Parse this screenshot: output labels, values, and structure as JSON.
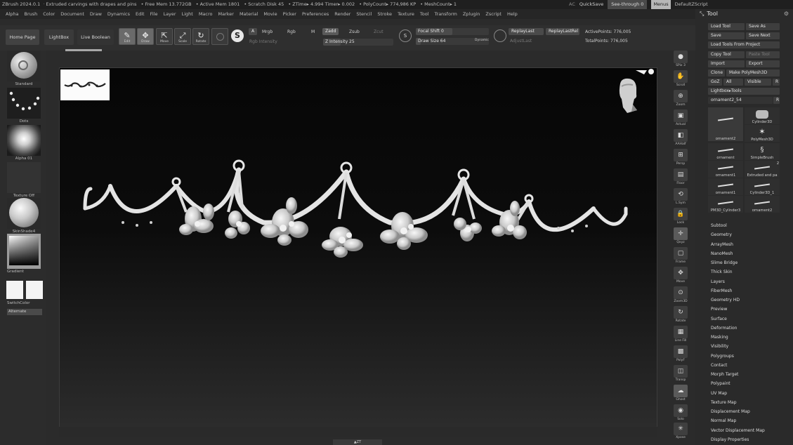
{
  "titlebar": {
    "segments": [
      "ZBrush 2024.0.1",
      "Extruded carvings with drapes and pins",
      "• Free Mem 13.772GB",
      "• Active Mem 1801",
      "• Scratch Disk 45",
      "• ZTime▸ 4.994 Timer▸ 0.002",
      "• PolyCount▸ 774,986 KP",
      "• MeshCount▸ 1"
    ],
    "ac_label": "AC",
    "quicksave": "QuickSave",
    "seethrough": "See-through 0",
    "menus": "Menus",
    "zscript": "DefaultZScript"
  },
  "menubar": [
    "Alpha",
    "Brush",
    "Color",
    "Document",
    "Draw",
    "Dynamics",
    "Edit",
    "File",
    "Layer",
    "Light",
    "Macro",
    "Marker",
    "Material",
    "Movie",
    "Picker",
    "Preferences",
    "Render",
    "Stencil",
    "Stroke",
    "Texture",
    "Tool",
    "Transform",
    "Zplugin",
    "Zscript",
    "Help"
  ],
  "toolbar": {
    "home": "Home Page",
    "lightbox": "LightBox",
    "live_boolean": "Live Boolean",
    "edit": "Edit",
    "draw": "Draw",
    "move": "Move",
    "scale": "Scale",
    "rotate": "Rotate",
    "a_toggle": "A",
    "mrgb": "Mrgb",
    "rgb": "Rgb",
    "m": "M",
    "zadd": "Zadd",
    "zsub": "Zsub",
    "zcut": "Zcut",
    "rgb_intensity": "Rgb Intensity",
    "z_intensity": "Z Intensity 25",
    "z_intensity_value": 25,
    "focal_shift": "Focal Shift 0",
    "focal_shift_value": 0,
    "draw_size": "Draw Size 64",
    "draw_size_value": 64,
    "dynamic": "Dynamic",
    "replay_last": "ReplayLast",
    "replay_last_rel": "ReplayLastRel",
    "adjust_last": "AdjustLast",
    "active_points": "ActivePoints: 776,005",
    "total_points": "TotalPoints: 776,005"
  },
  "leftshelf": {
    "brush": "Standard",
    "stroke": "Dots",
    "alpha": "Alpha 01",
    "texture": "Texture Off",
    "material": "SkinShade4",
    "gradient": "Gradient",
    "switchcolor": "SwitchColor",
    "alternate": "Alternate"
  },
  "rightshelf": [
    {
      "icon": "sphere-icon",
      "label": "SPix 3"
    },
    {
      "icon": "hand-icon",
      "label": "Scroll"
    },
    {
      "icon": "zoom-icon",
      "label": "Zoom"
    },
    {
      "icon": "actual-icon",
      "label": "Actual"
    },
    {
      "icon": "aahalf-icon",
      "label": "AAHalf"
    },
    {
      "icon": "persp-icon",
      "label": "Persp"
    },
    {
      "icon": "floor-icon",
      "label": "Floor"
    },
    {
      "icon": "local-icon",
      "label": "L.Sym"
    },
    {
      "icon": "lock-icon",
      "label": "Lock"
    },
    {
      "icon": "gizmo-icon",
      "label": "Qxyz"
    },
    {
      "icon": "frame-icon",
      "label": "Frame"
    },
    {
      "icon": "move-icon",
      "label": "Move"
    },
    {
      "icon": "zoom3d-icon",
      "label": "Zoom3D"
    },
    {
      "icon": "rotate-icon",
      "label": "Rotate"
    },
    {
      "icon": "linefill-icon",
      "label": "Line Fill"
    },
    {
      "icon": "polyf-icon",
      "label": "PolyF"
    },
    {
      "icon": "transp-icon",
      "label": "Transp"
    },
    {
      "icon": "ghost-icon",
      "label": "Ghost"
    },
    {
      "icon": "solo-icon",
      "label": "Solo"
    },
    {
      "icon": "xpose-icon",
      "label": "Xpose"
    }
  ],
  "tool": {
    "title": "Tool",
    "load_tool": "Load Tool",
    "save_as": "Save As",
    "save": "Save",
    "save_next": "Save Next",
    "load_from_project": "Load Tools From Project",
    "copy_tool": "Copy Tool",
    "paste_tool": "Paste Tool",
    "import": "Import",
    "export": "Export",
    "clone": "Clone",
    "make_polymesh": "Make PolyMesh3D",
    "goz": "GoZ",
    "all": "All",
    "visible": "Visible",
    "r": "R",
    "lightbox_tools": "Lightbox▸Tools",
    "current": "ornament2_54",
    "tiles": [
      {
        "label": "ornament2",
        "badge": ""
      },
      {
        "label": "Cylinder3D",
        "badge": ""
      },
      {
        "label": "PolyMesh3D",
        "badge": ""
      },
      {
        "label": "ornament",
        "badge": ""
      },
      {
        "label": "SimpleBrush",
        "badge": ""
      },
      {
        "label": "ornament1",
        "badge": ""
      },
      {
        "label": "Extruded and pa",
        "badge": "2"
      },
      {
        "label": "ornament1",
        "badge": ""
      },
      {
        "label": "Cylinder3D_1",
        "badge": ""
      },
      {
        "label": "PM3D_Cylinder3",
        "badge": ""
      },
      {
        "label": "ornament2",
        "badge": ""
      }
    ],
    "subpalettes": [
      "Subtool",
      "Geometry",
      "ArrayMesh",
      "NanoMesh",
      "Slime Bridge",
      "Thick Skin",
      "Layers",
      "FiberMesh",
      "Geometry HD",
      "Preview",
      "Surface",
      "Deformation",
      "Masking",
      "Visibility",
      "Polygroups",
      "Contact",
      "Morph Target",
      "Polypaint",
      "UV Map",
      "Texture Map",
      "Displacement Map",
      "Normal Map",
      "Vector Displacement Map",
      "Display Properties"
    ]
  },
  "bottom": {
    "label": "▲ZT"
  }
}
